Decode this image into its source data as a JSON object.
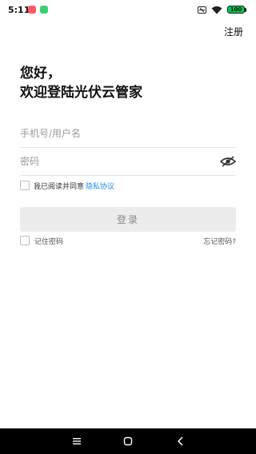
{
  "status_bar": {
    "time": "5:11",
    "battery": "100",
    "colors": {
      "app_icon_1": "#ff5a5f",
      "app_icon_2": "#3ccf6e",
      "battery": "#00c853"
    }
  },
  "header": {
    "register_label": "注册"
  },
  "greeting": {
    "line1": "您好，",
    "line2": "欢迎登陆光伏云管家"
  },
  "form": {
    "phone_placeholder": "手机号/用户名",
    "password_placeholder": "密码"
  },
  "agreement": {
    "text": "我已阅读并同意",
    "link": "隐私协议",
    "link_color": "#1e88e5"
  },
  "login": {
    "label": "登录"
  },
  "remember": {
    "label": "记住密码"
  },
  "forgot": {
    "label": "忘记密码?"
  },
  "icons": {
    "password_visibility": "eye-off-icon",
    "nav_menu": "menu-icon",
    "nav_home": "home-icon",
    "nav_back": "back-icon"
  }
}
